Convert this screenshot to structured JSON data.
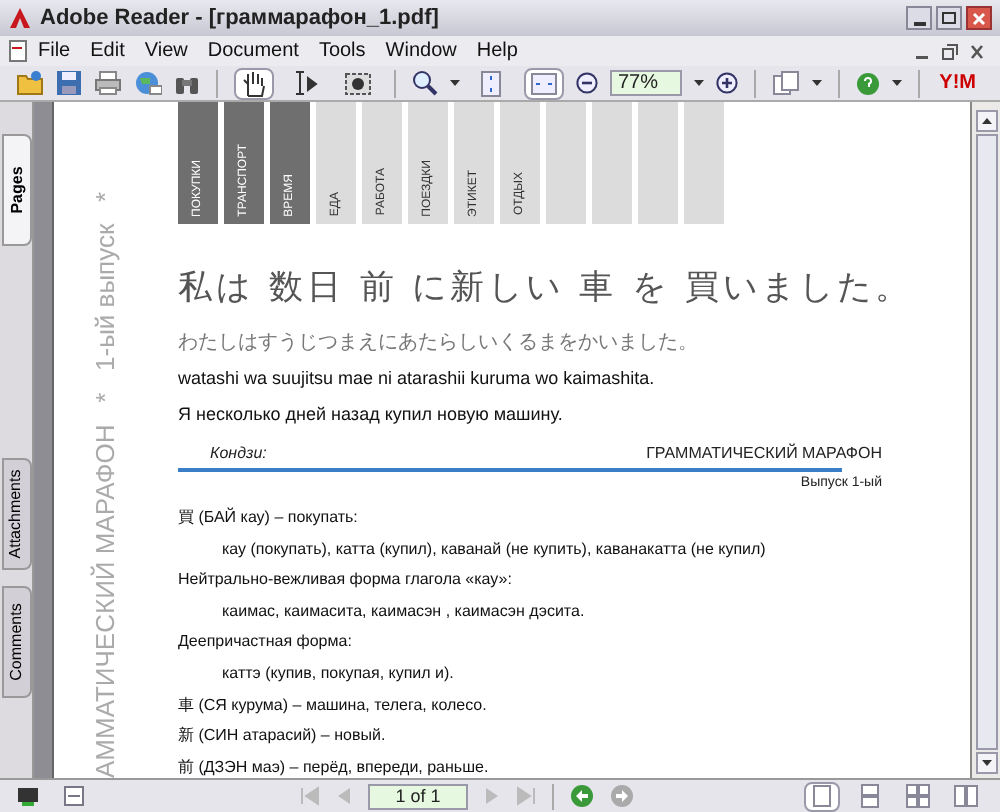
{
  "window": {
    "title": "Adobe Reader - [граммарафон_1.pdf]"
  },
  "menu": [
    "File",
    "Edit",
    "View",
    "Document",
    "Tools",
    "Window",
    "Help"
  ],
  "toolbar": {
    "zoom": "77%",
    "tools": [
      {
        "kind": "hand",
        "selected": true
      },
      {
        "kind": "select",
        "selected": false
      },
      {
        "kind": "snapshot",
        "selected": false
      }
    ],
    "fit": [
      {
        "kind": "page",
        "selected": false
      },
      {
        "kind": "width",
        "selected": true
      }
    ],
    "logo": "Y!M"
  },
  "side_tabs": [
    {
      "label": "Pages",
      "selected": true
    },
    {
      "label": "Attachments",
      "selected": false
    },
    {
      "label": "Comments",
      "selected": false
    }
  ],
  "document": {
    "margin_title": "АММАТИЧЕСКИЙ МАРАФОН   *   1-ый выпуск   *",
    "categories": [
      {
        "label": "ПОКУПКИ",
        "selected": true
      },
      {
        "label": "ТРАНСПОРТ",
        "selected": true
      },
      {
        "label": "ВРЕМЯ",
        "selected": true
      },
      {
        "label": "ЕДА",
        "selected": false
      },
      {
        "label": "РАБОТА",
        "selected": false
      },
      {
        "label": "ПОЕЗДКИ",
        "selected": false
      },
      {
        "label": "ЭТИКЕТ",
        "selected": false
      },
      {
        "label": "ОТДЫХ",
        "selected": false
      },
      {
        "selected": false
      },
      {
        "selected": false
      },
      {
        "selected": false
      },
      {
        "selected": false
      }
    ],
    "sentence": "私は 数日 前 に新しい 車 を 買いました。",
    "kana": "わたしはすうじつまえにあたらしいくるまをかいました。",
    "romaji": "watashi wa suujitsu mae ni atarashii kuruma wo kaimashita.",
    "translation": "Я несколько дней назад купил новую машину.",
    "section": "Кондзи:",
    "header_title": "ГРАММАТИЧЕСКИЙ МАРАФОН",
    "header_issue": "Выпуск 1-ый",
    "lines": [
      {
        "text": "買 (БАЙ кау) – покупать:",
        "indent": false
      },
      {
        "text": "кау (покупать), катта (купил), каванай (не купить), каванакатта (не купил)",
        "indent": true
      },
      {
        "text": "Нейтрально-вежливая форма глагола «кау»:",
        "indent": false
      },
      {
        "text": "каимас, каимасита, каимасэн , каимасэн дэсита.",
        "indent": true
      },
      {
        "text": "Деепричастная форма:",
        "indent": false
      },
      {
        "text": "каттэ (купив, покупая, купил и).",
        "indent": true
      },
      {
        "text": "車 (СЯ курума) – машина, телега, колесо.",
        "indent": false
      },
      {
        "text": "新 (СИН атарасий) – новый.",
        "indent": false
      },
      {
        "text": "前 (ДЗЭН маэ) – перёд, впереди, раньше.",
        "indent": false
      }
    ]
  },
  "status_bar": {
    "page": "1 of 1",
    "views": [
      {
        "selected": true
      },
      {
        "selected": false
      },
      {
        "selected": false
      },
      {
        "selected": false
      }
    ]
  }
}
